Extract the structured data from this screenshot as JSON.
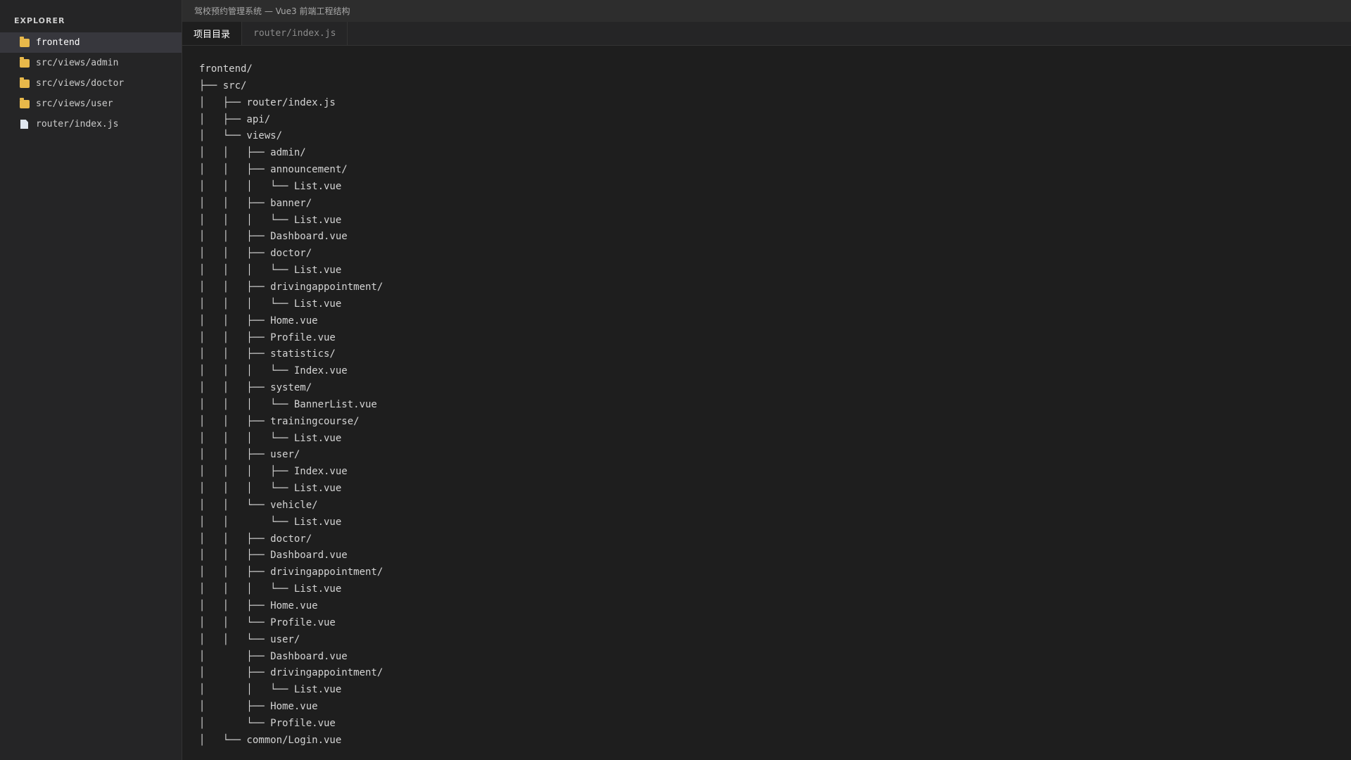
{
  "sidebar": {
    "title": "EXPLORER",
    "items": [
      {
        "label": "frontend",
        "icon": "folder-icon",
        "active": true
      },
      {
        "label": "src/views/admin",
        "icon": "folder-icon",
        "active": false
      },
      {
        "label": "src/views/doctor",
        "icon": "folder-icon",
        "active": false
      },
      {
        "label": "src/views/user",
        "icon": "folder-icon",
        "active": false
      },
      {
        "label": "router/index.js",
        "icon": "file-icon",
        "active": false
      }
    ]
  },
  "window": {
    "title": "驾校预约管理系统 — Vue3 前端工程结构"
  },
  "tabs": [
    {
      "label": "项目目录",
      "active": true
    },
    {
      "label": "router/index.js",
      "active": false
    }
  ],
  "tree": [
    "frontend/",
    "├── src/",
    "│   ├── router/index.js",
    "│   ├── api/",
    "│   └── views/",
    "│   │   ├── admin/",
    "│   │   ├── announcement/",
    "│   │   │   └── List.vue",
    "│   │   ├── banner/",
    "│   │   │   └── List.vue",
    "│   │   ├── Dashboard.vue",
    "│   │   ├── doctor/",
    "│   │   │   └── List.vue",
    "│   │   ├── drivingappointment/",
    "│   │   │   └── List.vue",
    "│   │   ├── Home.vue",
    "│   │   ├── Profile.vue",
    "│   │   ├── statistics/",
    "│   │   │   └── Index.vue",
    "│   │   ├── system/",
    "│   │   │   └── BannerList.vue",
    "│   │   ├── trainingcourse/",
    "│   │   │   └── List.vue",
    "│   │   ├── user/",
    "│   │   │   ├── Index.vue",
    "│   │   │   └── List.vue",
    "│   │   └── vehicle/",
    "│   │       └── List.vue",
    "│   │   ├── doctor/",
    "│   │   ├── Dashboard.vue",
    "│   │   ├── drivingappointment/",
    "│   │   │   └── List.vue",
    "│   │   ├── Home.vue",
    "│   │   └── Profile.vue",
    "│   │   └── user/",
    "│       ├── Dashboard.vue",
    "│       ├── drivingappointment/",
    "│       │   └── List.vue",
    "│       ├── Home.vue",
    "│       └── Profile.vue",
    "│   └── common/Login.vue"
  ],
  "colors": {
    "sidebar_bg": "#252526",
    "editor_bg": "#1e1e1e",
    "folder": "#e8b84a",
    "active_item_bg": "#37373d"
  }
}
